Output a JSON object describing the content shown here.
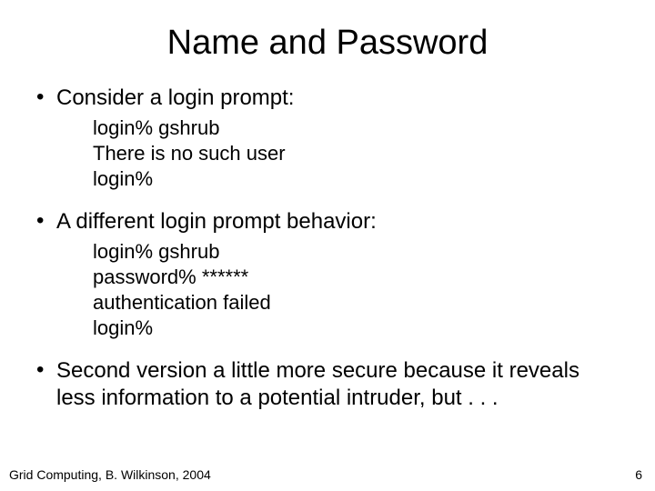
{
  "title": "Name and Password",
  "bullets": [
    {
      "text": "Consider a login prompt:",
      "sub": [
        "login%  gshrub",
        "There is no such user",
        "login%"
      ]
    },
    {
      "text": "A different login prompt behavior:",
      "sub": [
        "login%  gshrub",
        "password% ******",
        "authentication failed",
        "login%"
      ]
    },
    {
      "text": "Second version a little more secure because it reveals less information to a potential intruder, but . . .",
      "sub": []
    }
  ],
  "footer": {
    "left": "Grid Computing, B. Wilkinson, 2004",
    "page": "6"
  }
}
